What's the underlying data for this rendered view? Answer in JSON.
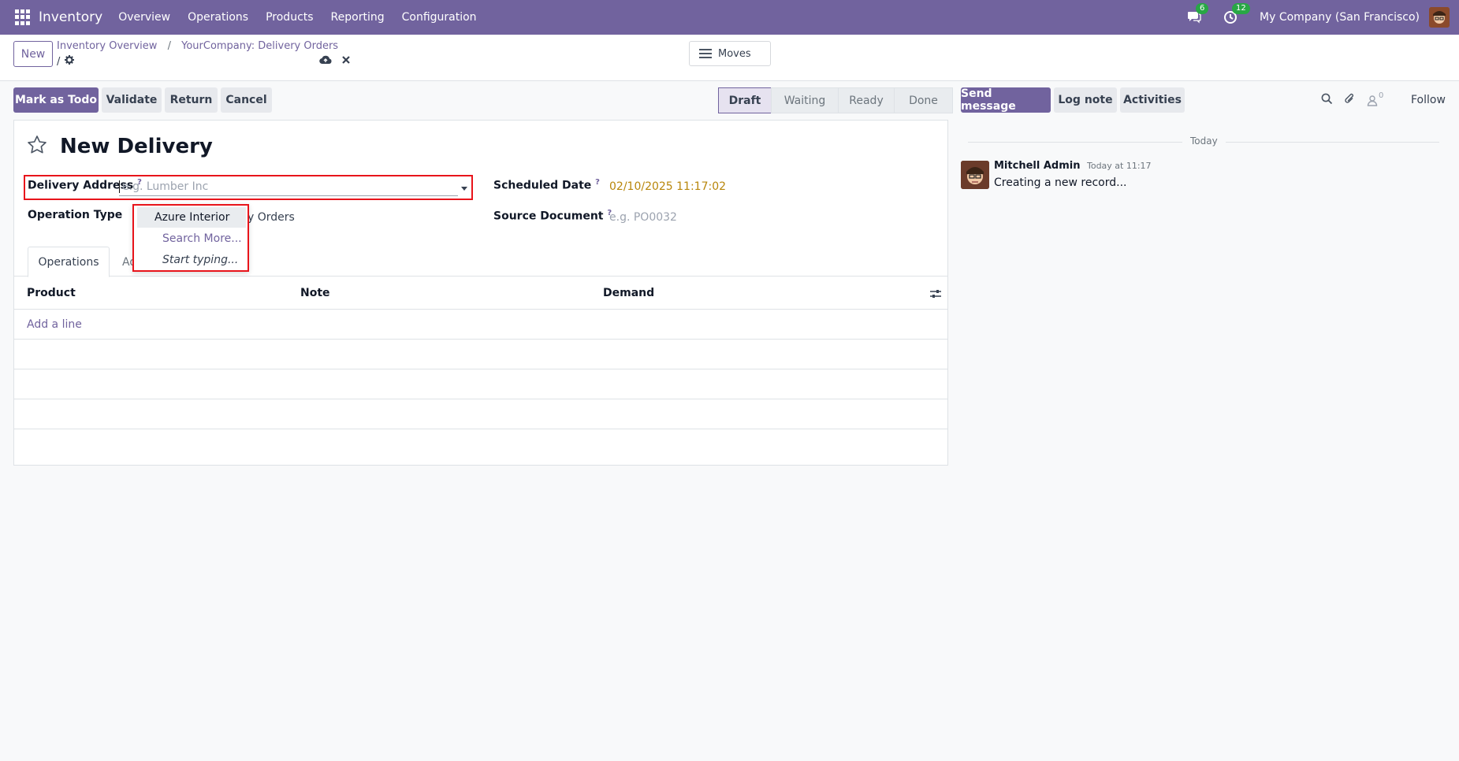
{
  "navbar": {
    "app_title": "Inventory",
    "menu": [
      "Overview",
      "Operations",
      "Products",
      "Reporting",
      "Configuration"
    ],
    "messages_count": "6",
    "activities_count": "12",
    "company": "My Company (San Francisco)"
  },
  "control": {
    "new_label": "New",
    "breadcrumb": [
      "Inventory Overview",
      "YourCompany: Delivery Orders"
    ],
    "bc_slash": "/",
    "moves_label": "Moves"
  },
  "actions": {
    "mark_todo": "Mark as Todo",
    "validate": "Validate",
    "return": "Return",
    "cancel": "Cancel"
  },
  "status": {
    "stages": [
      "Draft",
      "Waiting",
      "Ready",
      "Done"
    ],
    "active": "Draft"
  },
  "form": {
    "title": "New Delivery",
    "delivery_address_label": "Delivery Address",
    "delivery_address_placeholder": "e.g. Lumber Inc",
    "operation_type_label": "Operation Type",
    "operation_type_value": "y Orders",
    "scheduled_date_label": "Scheduled Date",
    "scheduled_date_value": "02/10/2025 11:17:02",
    "source_document_label": "Source Document",
    "source_document_placeholder": "e.g. PO0032",
    "help_mark": "?",
    "tabs": [
      "Operations",
      "Ad"
    ],
    "columns": [
      "Product",
      "Note",
      "Demand"
    ],
    "add_line": "Add a line"
  },
  "dropdown": {
    "items": [
      "Azure Interior",
      "Search More...",
      "Start typing..."
    ]
  },
  "chatter": {
    "send_message": "Send message",
    "log_note": "Log note",
    "activities": "Activities",
    "followers_count": "0",
    "follow": "Follow",
    "today": "Today",
    "author": "Mitchell Admin",
    "time": "Today at 11:17",
    "message": "Creating a new record..."
  },
  "colors": {
    "brand": "#71639e",
    "highlight_box": "#e8141b",
    "date_value": "#b8860b"
  }
}
